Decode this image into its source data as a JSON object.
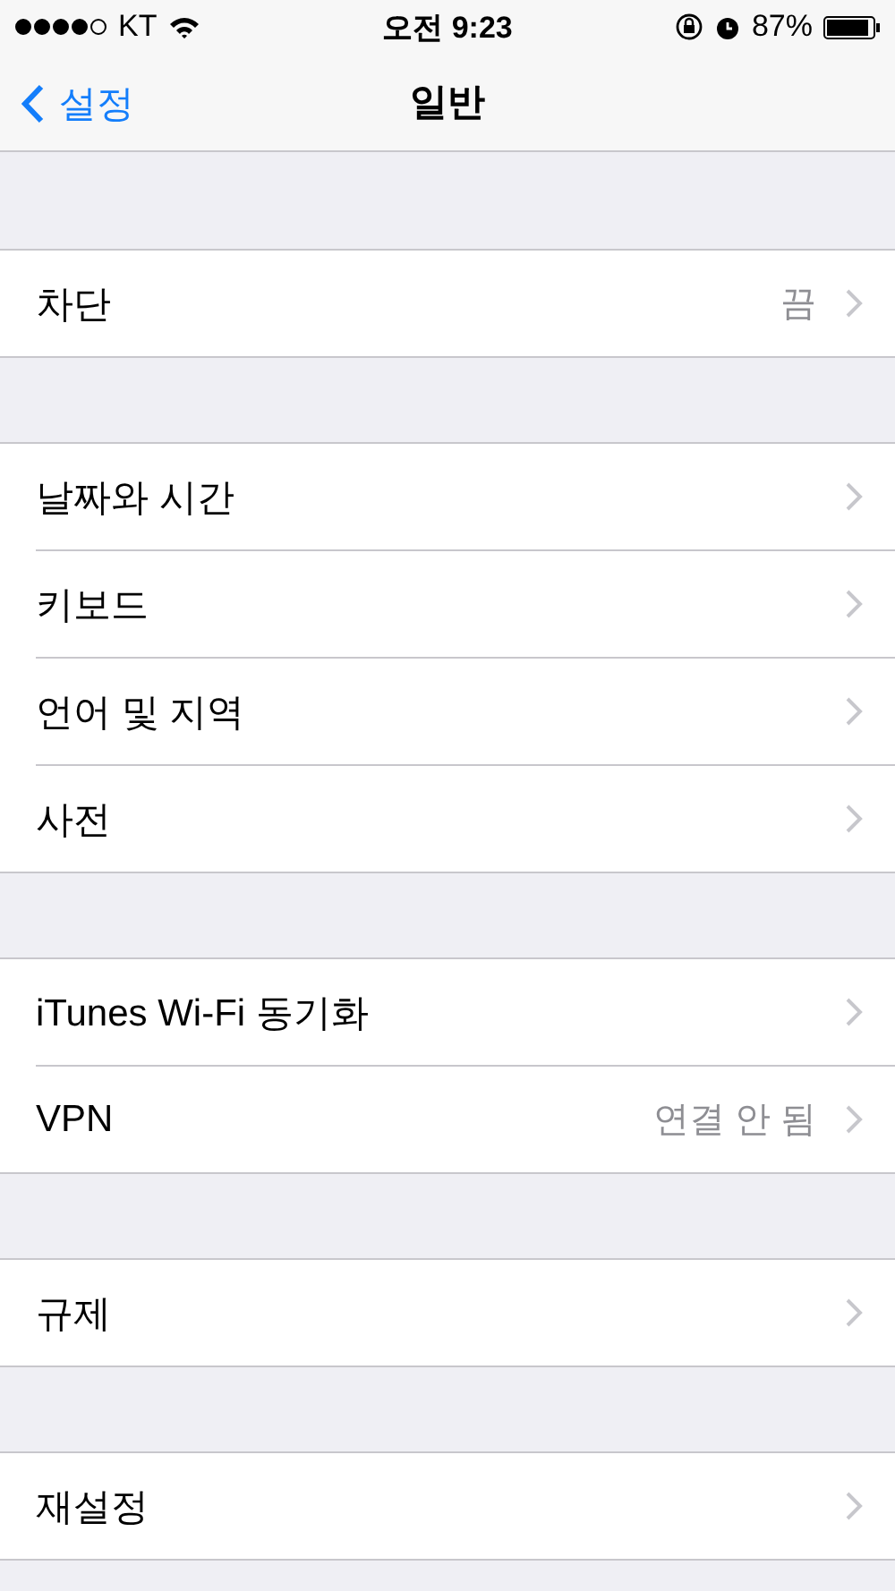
{
  "status_bar": {
    "carrier": "KT",
    "time": "오전 9:23",
    "battery": "87%"
  },
  "nav_bar": {
    "back": "설정",
    "title": "일반"
  },
  "sections": [
    {
      "rows": [
        {
          "label": "차단",
          "value": "끔"
        }
      ]
    },
    {
      "rows": [
        {
          "label": "날짜와 시간"
        },
        {
          "label": "키보드"
        },
        {
          "label": "언어 및 지역"
        },
        {
          "label": "사전"
        }
      ]
    },
    {
      "rows": [
        {
          "label": "iTunes Wi-Fi 동기화"
        },
        {
          "label": "VPN",
          "value": "연결 안 됨"
        }
      ]
    },
    {
      "rows": [
        {
          "label": "규제"
        }
      ]
    },
    {
      "rows": [
        {
          "label": "재설정"
        }
      ]
    }
  ]
}
